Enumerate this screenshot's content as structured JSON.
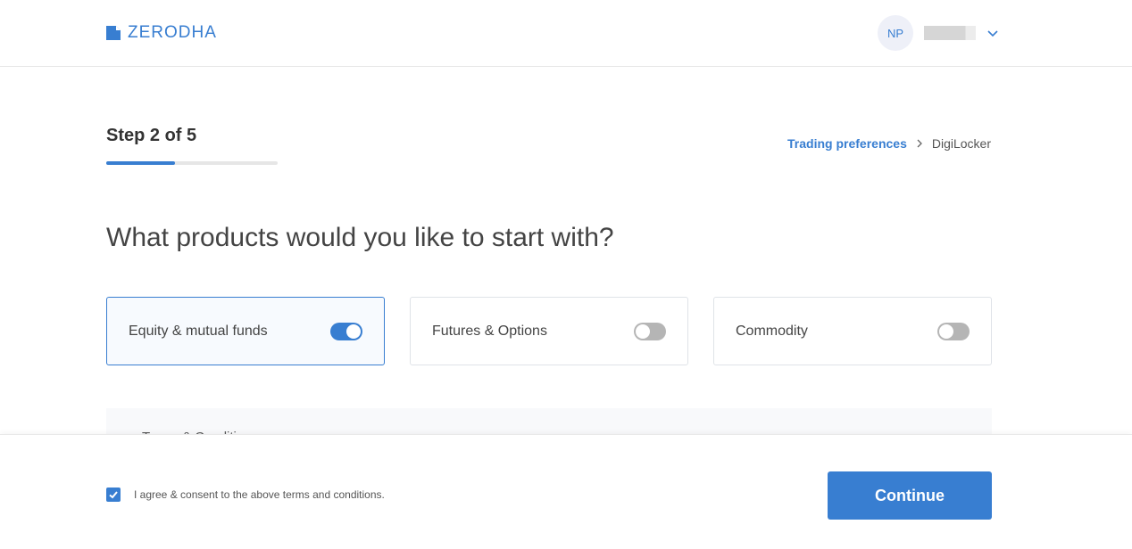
{
  "header": {
    "brand": "ZERODHA",
    "avatar_initials": "NP",
    "accent": "#387ed1"
  },
  "step": {
    "label": "Step 2 of 5",
    "current": 2,
    "total": 5,
    "progress_fraction": 0.4
  },
  "breadcrumb": {
    "current_section": "Trading preferences",
    "next_section": "DigiLocker"
  },
  "question": "What products would you like to start with?",
  "products": [
    {
      "label": "Equity & mutual funds",
      "enabled": true
    },
    {
      "label": "Futures & Options",
      "enabled": false
    },
    {
      "label": "Commodity",
      "enabled": false
    }
  ],
  "terms": {
    "title": "Terms & Conditions"
  },
  "footer": {
    "consent_text": "I agree & consent to the above terms and conditions.",
    "consent_checked": true,
    "continue_label": "Continue"
  }
}
